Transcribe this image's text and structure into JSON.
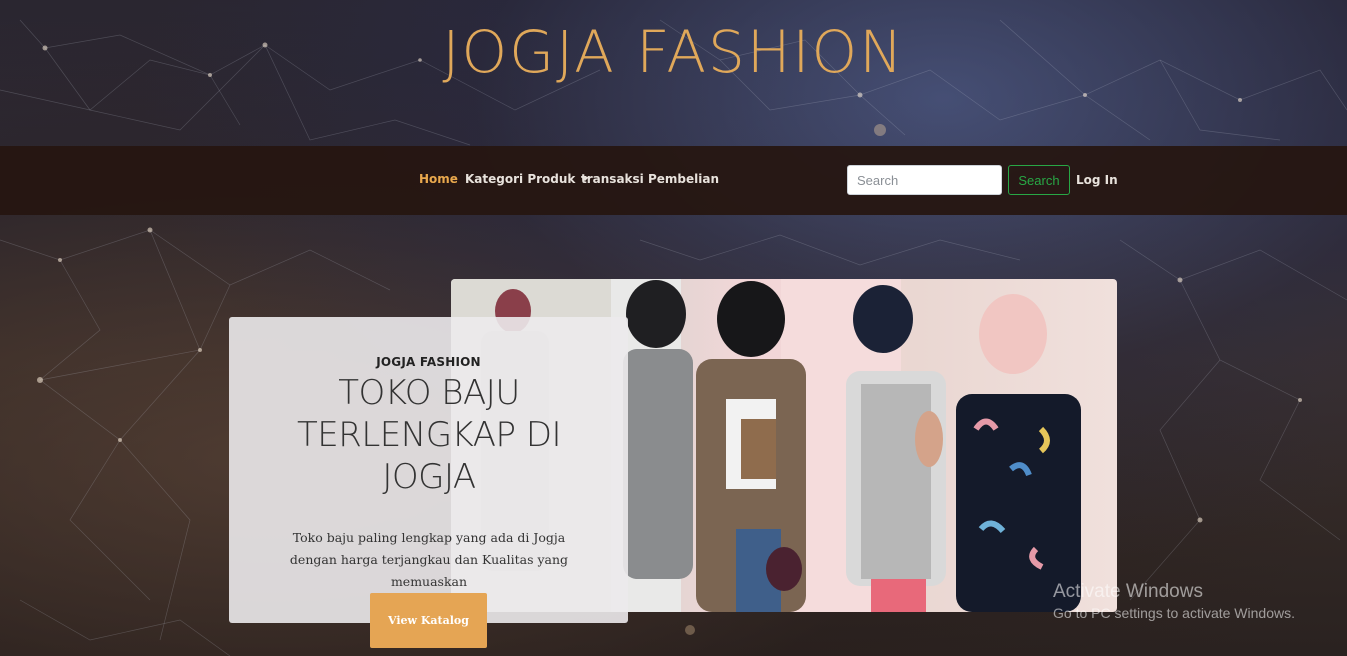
{
  "site": {
    "title": "JOGJA FASHION"
  },
  "nav": {
    "items": [
      {
        "label": "Home",
        "active": true
      },
      {
        "label": "Kategori Produk",
        "dropdown": true
      },
      {
        "label": "transaksi Pembelian"
      }
    ],
    "search_placeholder": "Search",
    "search_button": "Search",
    "login": "Log In"
  },
  "hero": {
    "label": "JOGJA FASHION",
    "heading": "TOKO BAJU TERLENGKAP DI JOGJA",
    "text": "Toko baju paling lengkap yang ada di Jogja dengan harga terjangkau dan Kualitas yang memuaskan",
    "button": "View Katalog"
  },
  "watermark": {
    "title": "Activate Windows",
    "subtitle": "Go to PC settings to activate Windows."
  },
  "colors": {
    "accent": "#e5a554",
    "title": "#e0a85a",
    "navbar": "#26160f",
    "search_button": "#28a745"
  },
  "icons": [
    "chevron-down-icon"
  ]
}
